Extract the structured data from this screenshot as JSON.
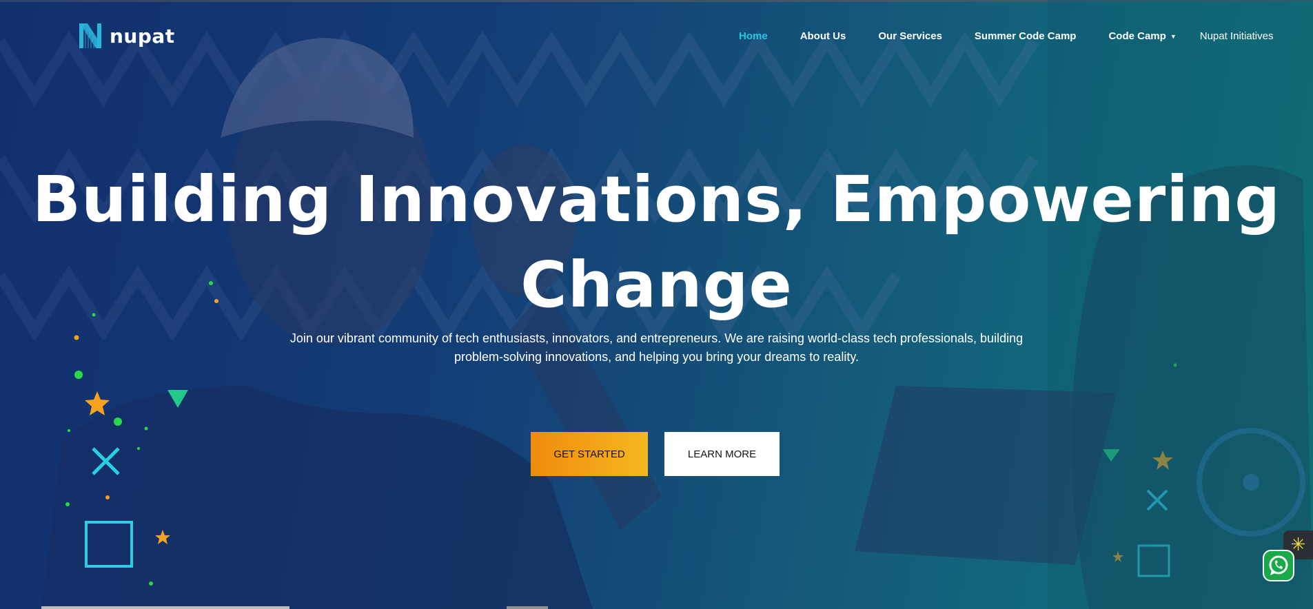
{
  "brand": {
    "name": "nupat",
    "logo_icon": "nupat-n-logo-icon"
  },
  "nav": {
    "items": [
      {
        "label": "Home",
        "active": true
      },
      {
        "label": "About Us"
      },
      {
        "label": "Our Services"
      },
      {
        "label": "Summer Code Camp"
      },
      {
        "label": "Code Camp",
        "has_dropdown": true
      },
      {
        "label": "Nupat Initiatives"
      }
    ],
    "caret": "▼"
  },
  "hero": {
    "headline_line1": "Building Innovations, Empowering",
    "headline_line2": "Change",
    "subtitle_line1": "Join our vibrant community of tech enthusiasts, innovators, and entrepreneurs. We are raising world-class tech professionals, building",
    "subtitle_line2": "problem-solving innovations, and helping you bring your dreams to reality.",
    "primary_button": "GET STARTED",
    "secondary_button": "LEARN MORE"
  },
  "colors": {
    "accent_cyan": "#25c7e6",
    "button_orange": "#f08b0d",
    "button_yellow": "#f5b81f",
    "bg_navy": "#14336e",
    "bg_teal": "#168080"
  },
  "widgets": {
    "whatsapp_icon": "whatsapp-icon",
    "settings_icon": "asterisk-settings-icon"
  }
}
